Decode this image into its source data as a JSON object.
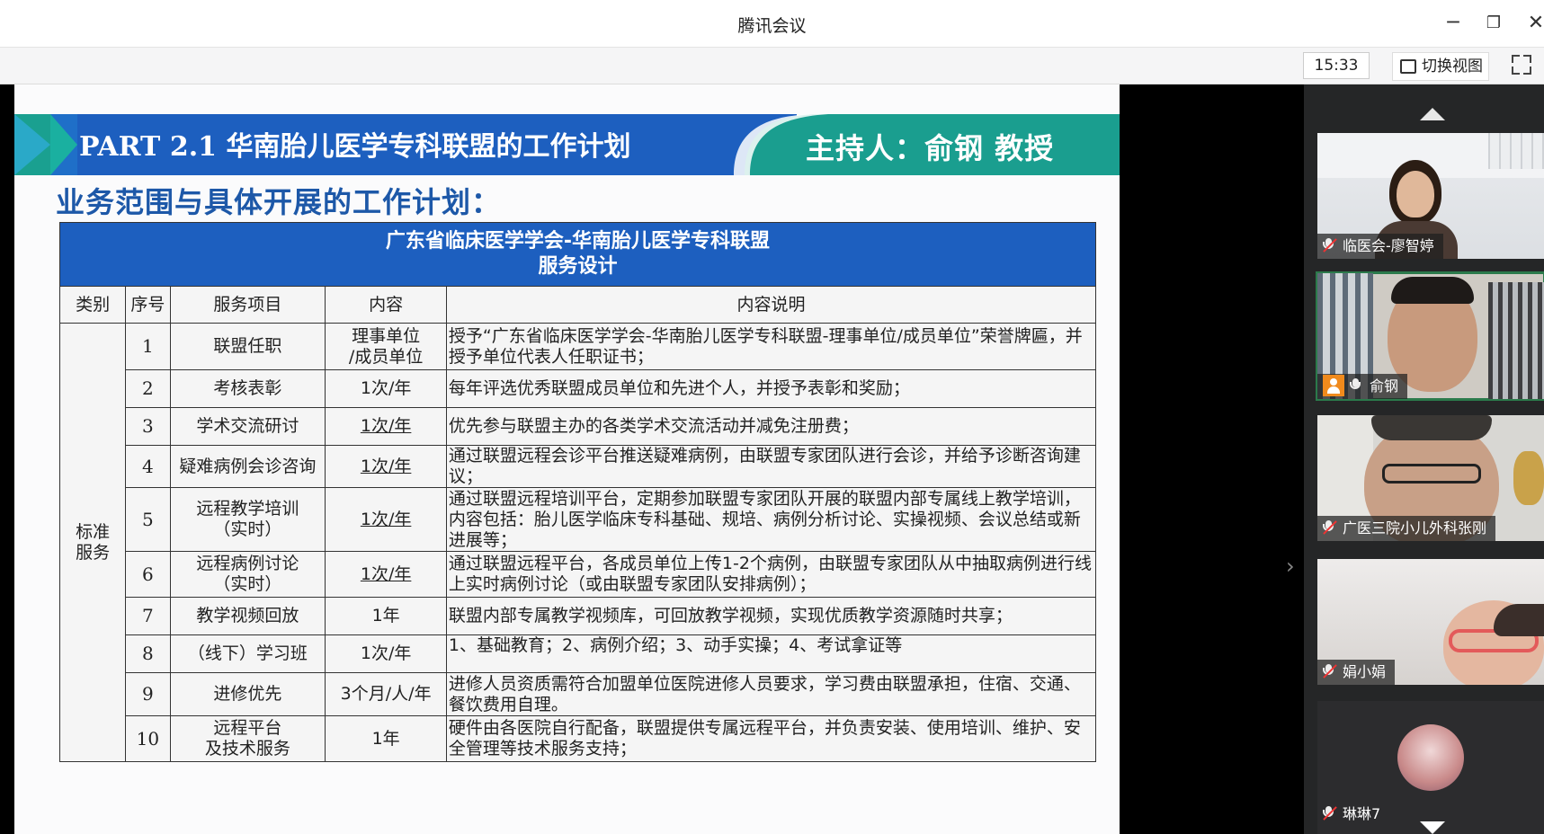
{
  "window": {
    "title": "腾讯会议"
  },
  "toolbar": {
    "time": "15:33",
    "switch_view_label": "切换视图"
  },
  "slide": {
    "banner_title": "PART 2.1 华南胎儿医学专科联盟的工作计划",
    "host": "主持人：俞钢 教授",
    "subtitle": "业务范围与具体开展的工作计划：",
    "table": {
      "caption_line1": "广东省临床医学学会-华南胎儿医学专科联盟",
      "caption_line2": "服务设计",
      "headers": [
        "类别",
        "序号",
        "服务项目",
        "内容",
        "内容说明"
      ],
      "category": [
        "标准",
        "服务"
      ],
      "rows": [
        {
          "no": "1",
          "item": [
            "联盟任职"
          ],
          "content": [
            "理事单位",
            "/成员单位"
          ],
          "desc": "授予“广东省临床医学学会-华南胎儿医学专科联盟-理事单位/成员单位”荣誉牌匾，并授予单位代表人任职证书；"
        },
        {
          "no": "2",
          "item": [
            "考核表彰"
          ],
          "content": [
            "1次/年"
          ],
          "desc": "每年评选优秀联盟成员单位和先进个人，并授予表彰和奖励；"
        },
        {
          "no": "3",
          "item": [
            "学术交流研讨"
          ],
          "content": [
            "1次/年"
          ],
          "desc": "优先参与联盟主办的各类学术交流活动并减免注册费；"
        },
        {
          "no": "4",
          "item": [
            "疑难病例会诊咨询"
          ],
          "content": [
            "1次/年"
          ],
          "desc": "通过联盟远程会诊平台推送疑难病例，由联盟专家团队进行会诊，并给予诊断咨询建议；"
        },
        {
          "no": "5",
          "item": [
            "远程教学培训",
            "（实时）"
          ],
          "content": [
            "1次/年"
          ],
          "desc": "通过联盟远程培训平台，定期参加联盟专家团队开展的联盟内部专属线上教学培训，内容包括：胎儿医学临床专科基础、规培、病例分析讨论、实操视频、会议总结或新进展等；"
        },
        {
          "no": "6",
          "item": [
            "远程病例讨论",
            "（实时）"
          ],
          "content": [
            "1次/年"
          ],
          "desc": "通过联盟远程平台，各成员单位上传1-2个病例，由联盟专家团队从中抽取病例进行线上实时病例讨论（或由联盟专家团队安排病例）；"
        },
        {
          "no": "7",
          "item": [
            "教学视频回放"
          ],
          "content": [
            "1年"
          ],
          "desc": "联盟内部专属教学视频库，可回放教学视频，实现优质教学资源随时共享；"
        },
        {
          "no": "8",
          "item": [
            "（线下）学习班"
          ],
          "content": [
            "1次/年"
          ],
          "desc": "1、基础教育；2、病例介绍；3、动手实操；4、考试拿证等"
        },
        {
          "no": "9",
          "item": [
            "进修优先"
          ],
          "content": [
            "3个月/人/年"
          ],
          "desc": "进修人员资质需符合加盟单位医院进修人员要求，学习费由联盟承担，住宿、交通、餐饮费用自理。"
        },
        {
          "no": "10",
          "item": [
            "远程平台",
            "及技术服务"
          ],
          "content": [
            "1年"
          ],
          "desc": "硬件由各医院自行配备，联盟提供专属远程平台，并负责安装、使用培训、维护、安全管理等技术服务支持；"
        }
      ]
    }
  },
  "participants": [
    {
      "name": "临医会-廖智婷",
      "muted": true
    },
    {
      "name": "俞钢",
      "muted": false,
      "speaking": true
    },
    {
      "name": "广医三院小儿外科张刚",
      "muted": true
    },
    {
      "name": "娟小娟",
      "muted": true
    },
    {
      "name": "琳琳7",
      "muted": true
    }
  ],
  "colors": {
    "banner_blue": "#1d5fbf",
    "banner_teal": "#1a9e8f",
    "subtitle_blue": "#1d58a8",
    "table_header": "#1d5fbf"
  }
}
